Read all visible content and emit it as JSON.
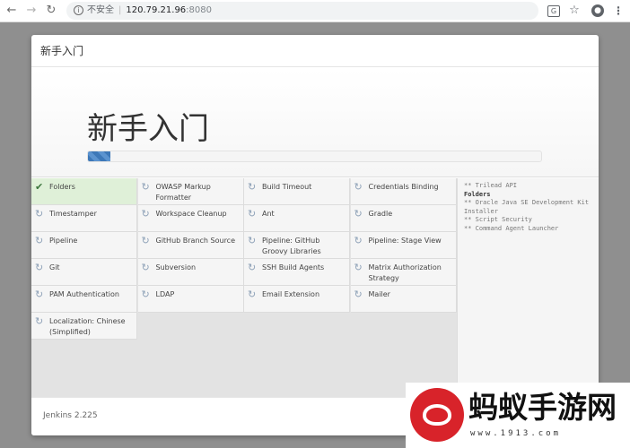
{
  "browser": {
    "back_icon": "back-arrow-icon",
    "forward_icon": "forward-arrow-icon",
    "reload_icon": "reload-icon",
    "security_label": "不安全",
    "url_host": "120.79.21.96",
    "url_port": ":8080"
  },
  "dialog": {
    "header_title": "新手入门",
    "hero_title": "新手入门",
    "progress": 0.05,
    "version": "Jenkins 2.225"
  },
  "plugins": [
    {
      "name": "Folders",
      "status": "success"
    },
    {
      "name": "OWASP Markup Formatter",
      "status": "pending"
    },
    {
      "name": "Build Timeout",
      "status": "pending"
    },
    {
      "name": "Credentials Binding",
      "status": "pending"
    },
    {
      "name": "Timestamper",
      "status": "pending"
    },
    {
      "name": "Workspace Cleanup",
      "status": "pending"
    },
    {
      "name": "Ant",
      "status": "pending"
    },
    {
      "name": "Gradle",
      "status": "pending"
    },
    {
      "name": "Pipeline",
      "status": "pending"
    },
    {
      "name": "GitHub Branch Source",
      "status": "pending"
    },
    {
      "name": "Pipeline: GitHub Groovy Libraries",
      "status": "pending"
    },
    {
      "name": "Pipeline: Stage View",
      "status": "pending"
    },
    {
      "name": "Git",
      "status": "pending"
    },
    {
      "name": "Subversion",
      "status": "pending"
    },
    {
      "name": "SSH Build Agents",
      "status": "pending"
    },
    {
      "name": "Matrix Authorization Strategy",
      "status": "pending"
    },
    {
      "name": "PAM Authentication",
      "status": "pending"
    },
    {
      "name": "LDAP",
      "status": "pending"
    },
    {
      "name": "Email Extension",
      "status": "pending"
    },
    {
      "name": "Mailer",
      "status": "pending"
    },
    {
      "name": "Localization: Chinese (Simplified)",
      "status": "pending"
    }
  ],
  "log": [
    {
      "text": "** Trilead API",
      "bold": false
    },
    {
      "text": "Folders",
      "bold": true
    },
    {
      "text": "** Oracle Java SE Development Kit Installer",
      "bold": false
    },
    {
      "text": "** Script Security",
      "bold": false
    },
    {
      "text": "** Command Agent Launcher",
      "bold": false
    }
  ],
  "watermark": {
    "text": "蚂蚁手游网",
    "url": "www.1913.com"
  },
  "colors": {
    "success_bg": "#dff0d8",
    "progress": "#3d78b8",
    "watermark_logo": "#d8232a"
  }
}
